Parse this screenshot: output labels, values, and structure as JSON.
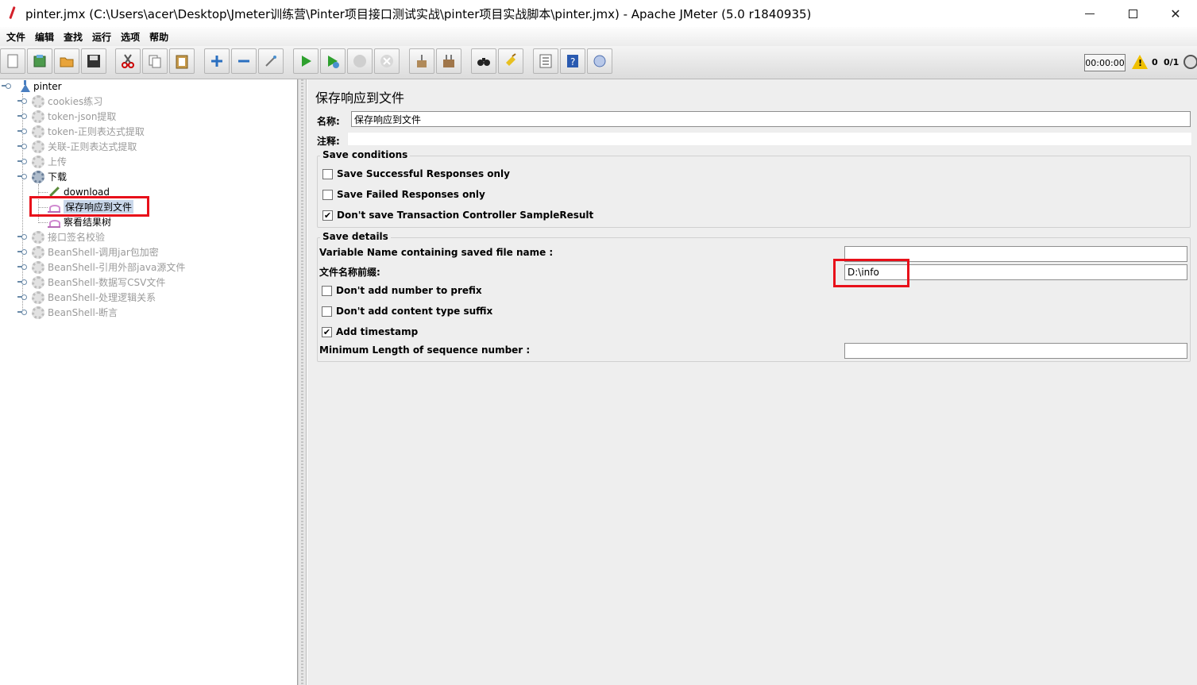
{
  "window": {
    "title": "pinter.jmx (C:\\Users\\acer\\Desktop\\Jmeter训练营\\Pinter项目接口测试实战\\pinter项目实战脚本\\pinter.jmx) - Apache JMeter (5.0 r1840935)",
    "close_glyph": "✕"
  },
  "menu": [
    "文件",
    "编辑",
    "查找",
    "运行",
    "选项",
    "帮助"
  ],
  "toolbar": {
    "timer": "00:00:00",
    "warning_count": "0",
    "thread_count": "0/1"
  },
  "tree": {
    "root": "pinter",
    "items": [
      "cookies练习",
      "token-json提取",
      "token-正则表达式提取",
      "关联-正则表达式提取",
      "上传",
      "下载",
      "download",
      "保存响应到文件",
      "察看结果树",
      "接口签名校验",
      "BeanShell-调用jar包加密",
      "BeanShell-引用外部java源文件",
      "BeanShell-数据写CSV文件",
      "BeanShell-处理逻辑关系",
      "BeanShell-断言"
    ]
  },
  "panel": {
    "title": "保存响应到文件",
    "name_label": "名称:",
    "name_value": "保存响应到文件",
    "comment_label": "注释:",
    "save_conditions": {
      "title": "Save conditions",
      "options": [
        {
          "label": "Save Successful Responses only",
          "checked": false
        },
        {
          "label": "Save Failed Responses only",
          "checked": false
        },
        {
          "label": "Don't save Transaction Controller SampleResult",
          "checked": true
        }
      ]
    },
    "save_details": {
      "title": "Save details",
      "variable_name_label": "Variable Name containing saved file name :",
      "variable_name_value": "",
      "prefix_label": "文件名称前缀:",
      "prefix_value": "D:\\info",
      "options": [
        {
          "label": "Don't add number to prefix",
          "checked": false
        },
        {
          "label": "Don't add content type suffix",
          "checked": false
        },
        {
          "label": "Add timestamp",
          "checked": true
        }
      ],
      "min_length_label": "Minimum Length of sequence number :",
      "min_length_value": ""
    }
  },
  "colors": {
    "highlight_red": "#e8101a",
    "selection": "#c9d7ea",
    "panel_bg": "#eeeeee"
  }
}
